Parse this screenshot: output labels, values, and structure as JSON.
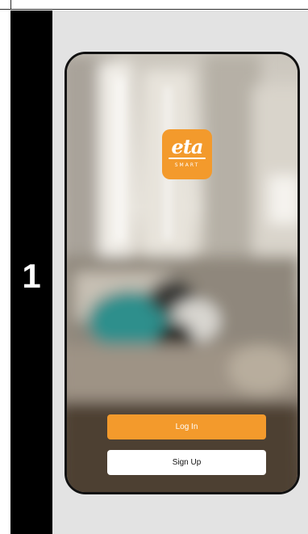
{
  "step": {
    "number": "1"
  },
  "app": {
    "logo": {
      "script_text": "eta",
      "sub_text": "SMART",
      "color": "#f39a2c"
    },
    "buttons": {
      "login_label": "Log In",
      "signup_label": "Sign Up"
    },
    "colors": {
      "accent": "#f39a2c",
      "secondary_button": "#ffffff",
      "step_column": "#000000"
    }
  }
}
